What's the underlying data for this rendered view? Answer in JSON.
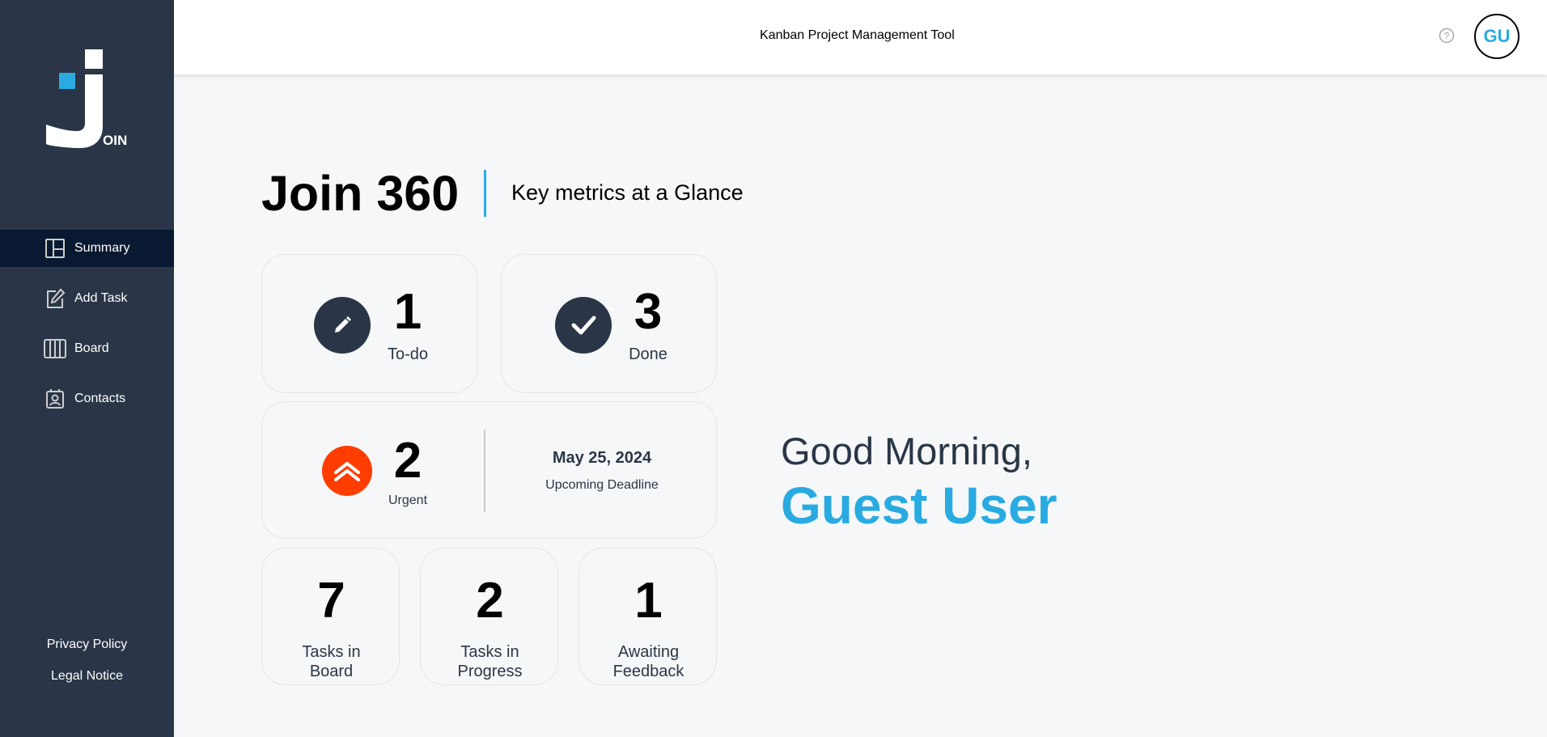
{
  "app": {
    "header_title": "Kanban Project Management Tool",
    "logo_text": "OIN",
    "user_initials": "GU"
  },
  "sidebar": {
    "items": [
      {
        "label": "Summary",
        "icon": "summary-icon",
        "active": true
      },
      {
        "label": "Add Task",
        "icon": "add-task-icon",
        "active": false
      },
      {
        "label": "Board",
        "icon": "board-icon",
        "active": false
      },
      {
        "label": "Contacts",
        "icon": "contacts-icon",
        "active": false
      }
    ],
    "footer_links": [
      "Privacy Policy",
      "Legal Notice"
    ]
  },
  "main": {
    "title": "Join 360",
    "subtitle": "Key metrics at a Glance",
    "metrics": {
      "todo": {
        "count": "1",
        "label": "To-do"
      },
      "done": {
        "count": "3",
        "label": "Done"
      },
      "urgent": {
        "count": "2",
        "label": "Urgent",
        "deadline_date": "May 25, 2024",
        "deadline_label": "Upcoming Deadline"
      },
      "board": {
        "count": "7",
        "label_line1": "Tasks in",
        "label_line2": "Board"
      },
      "progress": {
        "count": "2",
        "label_line1": "Tasks in",
        "label_line2": "Progress"
      },
      "feedback": {
        "count": "1",
        "label_line1": "Awaiting",
        "label_line2": "Feedback"
      }
    },
    "greeting": "Good Morning,",
    "user_name": "Guest User"
  },
  "colors": {
    "sidebar_bg": "#2a3647",
    "active_nav": "#091931",
    "accent": "#29abe2",
    "urgent": "#ff3d00"
  }
}
